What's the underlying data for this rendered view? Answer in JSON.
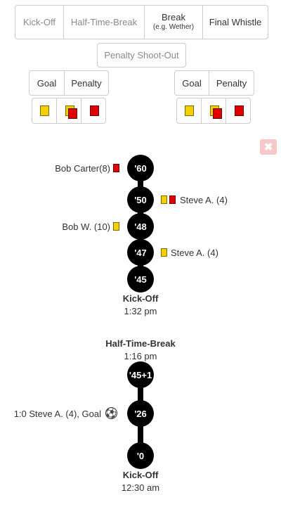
{
  "phase_buttons": {
    "kickoff": "Kick-Off",
    "halftime": "Half-Time-Break",
    "break_label": "Break",
    "break_sub": "(e.g. Wether)",
    "final": "Final Whistle",
    "penalty_shootout": "Penalty Shoot-Out"
  },
  "team_left": {
    "goal": "Goal",
    "penalty": "Penalty"
  },
  "team_right": {
    "goal": "Goal",
    "penalty": "Penalty"
  },
  "colors": {
    "yellow_card": "#f5d000",
    "red_card": "#e00000",
    "timeline": "#000000",
    "close_bg": "#f6c8c8"
  },
  "close_symbol": "✖",
  "timeline1": {
    "nodes": [
      "'60",
      "'50",
      "'48",
      "'47",
      "'45"
    ],
    "events": {
      "e60": "Bob Carter(8)",
      "e50": "Steve A. (4)",
      "e48": "Bob W. (10)",
      "e47": "Steve A. (4)"
    },
    "end_label": "Kick-Off",
    "end_time": "1:32 pm"
  },
  "halftime": {
    "label": "Half-Time-Break",
    "time": "1:16 pm"
  },
  "timeline2": {
    "nodes": [
      "'45+1",
      "'26",
      "'0"
    ],
    "events": {
      "e26": "1:0 Steve A. (4), Goal"
    },
    "ball_icon": "⚽",
    "end_label": "Kick-Off",
    "end_time": "12:30 am"
  }
}
